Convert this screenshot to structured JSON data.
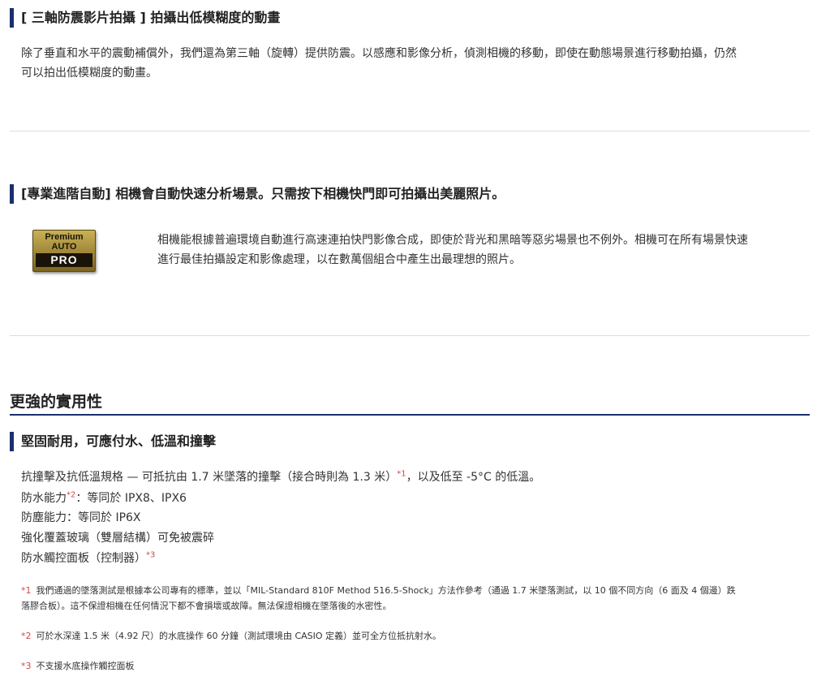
{
  "section1": {
    "heading": "[ 三軸防震影片拍攝 ] 拍攝出低模糊度的動畫",
    "body_line1": "除了垂直和水平的震動補償外，我們還為第三軸（旋轉）提供防震。以感應和影像分析，偵測相機的移動，即使在動態場景進行移動拍攝，仍然",
    "body_line2": "可以拍出低模糊度的動畫。"
  },
  "section2": {
    "heading": "[專業進階自動] 相機會自動快速分析場景。只需按下相機快門即可拍攝出美麗照片。",
    "logo": {
      "line1": "Premium",
      "line2": "AUTO",
      "line3": "PRO"
    },
    "body_line1": "相機能根據普遍環境自動進行高速連拍快門影像合成，即使於背光和黑暗等惡劣場景也不例外。相機可在所有場景快速",
    "body_line2": "進行最佳拍攝設定和影像處理，以在數萬個組合中產生出最理想的照片。"
  },
  "major_heading": "更強的實用性",
  "section3": {
    "heading": "堅固耐用，可應付水、低溫和撞擊",
    "specs": {
      "line1_pre": "抗撞擊及抗低溫規格 — 可抵抗由 1.7 米墜落的撞擊（接合時則為 1.3 米）",
      "line1_sup": "*1",
      "line1_post": "，以及低至 -5°C 的低溫。",
      "line2_pre": "防水能力",
      "line2_sup": "*2",
      "line2_post": "：等同於 IPX8、IPX6",
      "line3": "防塵能力：等同於 IP6X",
      "line4": "強化覆蓋玻璃（雙層結構）可免被震碎",
      "line5_pre": "防水觸控面板（控制器）",
      "line5_sup": "*3"
    },
    "notes": {
      "n1_mark": "*1",
      "n1_line1": "我們通過的墜落測試是根據本公司專有的標準，並以「MIL-Standard 810F Method 516.5-Shock」方法作參考（通過 1.7 米墜落測試，以 10 個不同方向（6 面及 4 個邊）跌",
      "n1_line2": "落膠合板）。這不保證相機在任何情況下都不會損壞或故障。無法保證相機在墜落後的水密性。",
      "n2_mark": "*2",
      "n2_text": "可於水深達 1.5 米（4.92 尺）的水底操作 60 分鐘（測試環境由 CASIO 定義）並可全方位抵抗射水。",
      "n3_mark": "*3",
      "n3_text": "不支援水底操作觸控面板"
    }
  },
  "colors": {
    "accent": "#1a2f6e",
    "footnote_mark": "#d04a4a",
    "divider": "#dcdcdc"
  }
}
